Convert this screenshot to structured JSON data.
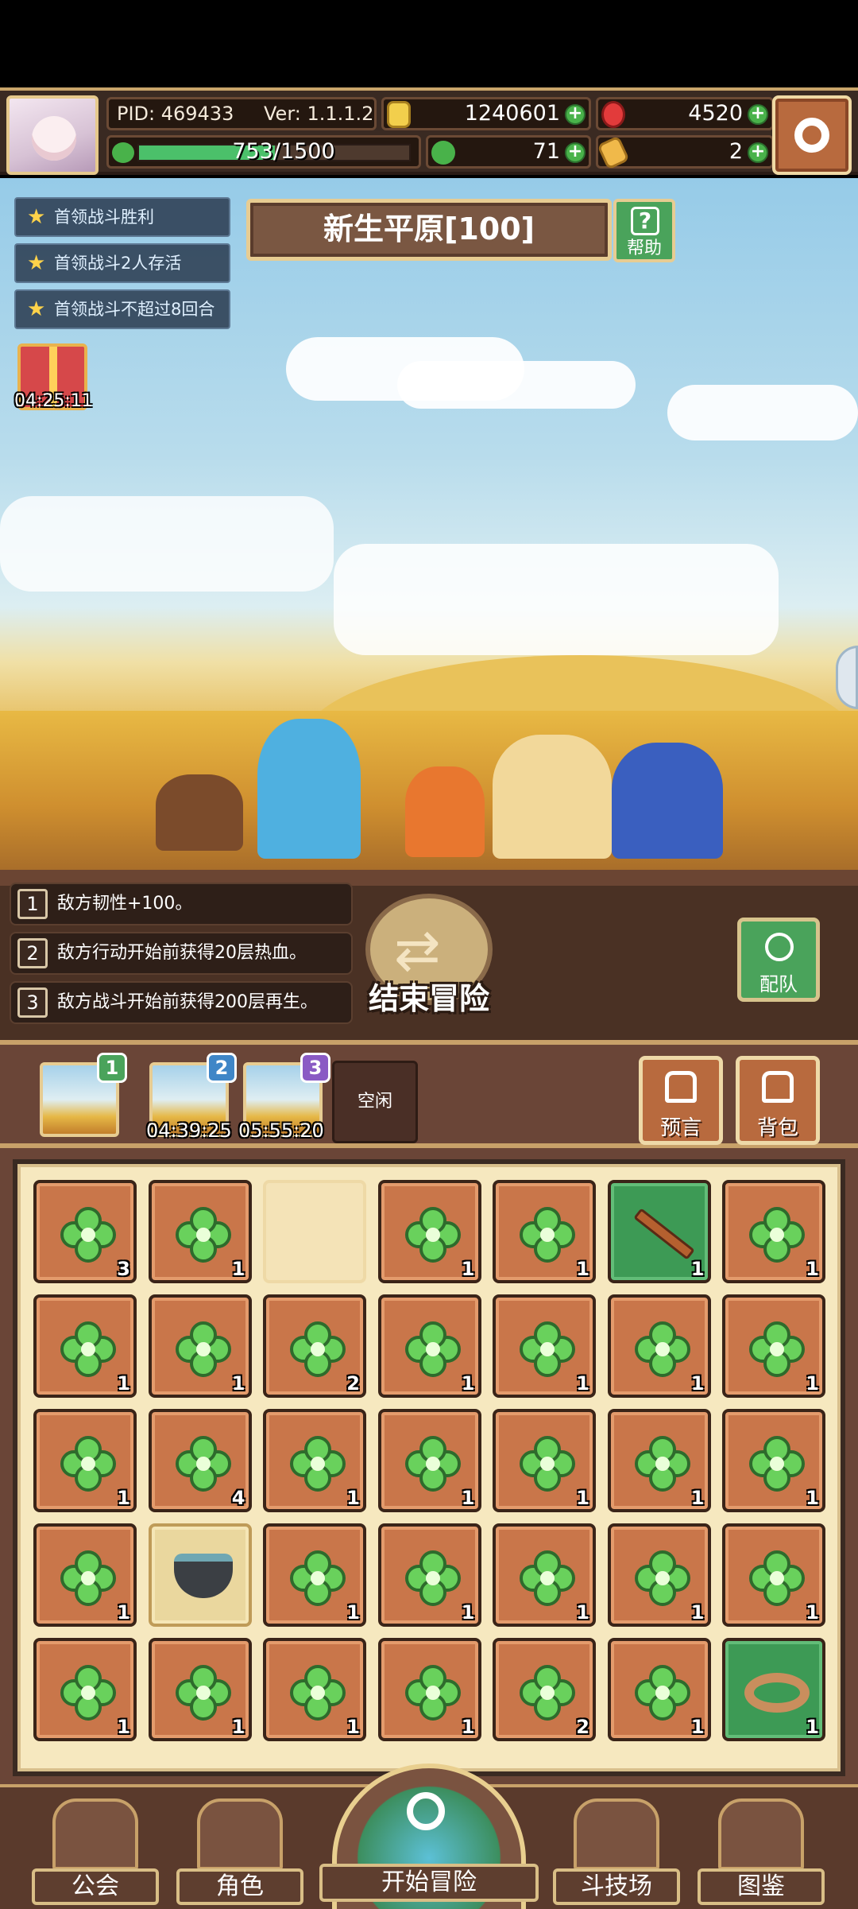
{
  "header": {
    "pid": "PID: 469433",
    "version": "Ver: 1.1.1.2",
    "gold": "1240601",
    "gems": "4520",
    "exp": "753/1500",
    "exp_fraction": 0.502,
    "clover": "71",
    "ticket": "2",
    "plus_symbol": "+"
  },
  "quests": [
    {
      "label": "首领战斗胜利"
    },
    {
      "label": "首领战斗2人存活"
    },
    {
      "label": "首领战斗不超过8回合"
    }
  ],
  "area": {
    "title": "新生平原[100]",
    "help_label": "帮助"
  },
  "gift": {
    "timer": "04:25:11"
  },
  "modifiers": [
    {
      "num": "1",
      "text": "敌方韧性+100。"
    },
    {
      "num": "2",
      "text": "敌方行动开始前获得20层热血。"
    },
    {
      "num": "3",
      "text": "敌方战斗开始前获得200层再生。"
    }
  ],
  "actions": {
    "end_adventure": "结束冒险",
    "team": "配队"
  },
  "slots": [
    {
      "badge": "1",
      "timer": ""
    },
    {
      "badge": "2",
      "timer": "04:39:25"
    },
    {
      "badge": "3",
      "timer": "05:55:20"
    }
  ],
  "idle_slot": "空闲",
  "buttons": {
    "prophecy": "预言",
    "bag": "背包"
  },
  "inventory": [
    [
      "3",
      "1",
      "",
      "1",
      "1",
      "1",
      "1"
    ],
    [
      "1",
      "1",
      "2",
      "1",
      "1",
      "1",
      "1"
    ],
    [
      "1",
      "4",
      "1",
      "1",
      "1",
      "1",
      "1"
    ],
    [
      "1",
      "",
      "1",
      "1",
      "1",
      "1",
      "1"
    ],
    [
      "1",
      "1",
      "1",
      "1",
      "2",
      "1",
      "1"
    ]
  ],
  "nav": {
    "guild": "公会",
    "character": "角色",
    "start": "开始冒险",
    "arena": "斗技场",
    "codex": "图鉴"
  },
  "colors": {
    "accent_gold": "#e7cc92",
    "panel_brown": "#6a4537",
    "item_orange": "#c9764a",
    "item_green": "#3d9a55"
  }
}
